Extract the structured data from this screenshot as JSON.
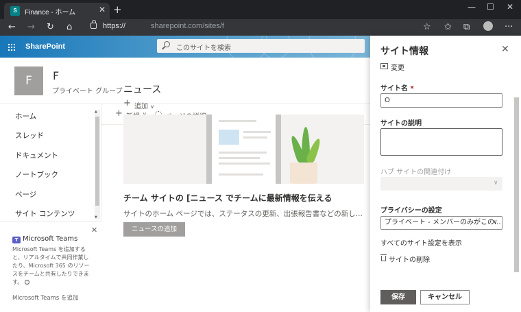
{
  "browser": {
    "tab_title": "Finance - ホーム",
    "tab_favicon": "S",
    "url_prefix": "https://",
    "url_domain": "sharepoint.com/sites/f",
    "icons": [
      "back-icon",
      "forward-icon",
      "refresh-icon",
      "home-icon",
      "lock-icon",
      "star-icon",
      "favorites-icon",
      "collections-icon",
      "profile-icon",
      "more-icon"
    ]
  },
  "suitebar": {
    "brand": "SharePoint",
    "search_placeholder": "このサイトを検索"
  },
  "site": {
    "logo_letter": "F",
    "title": "F",
    "subtitle": "プライベート グループ"
  },
  "nav": {
    "items": [
      "ホーム",
      "スレッド",
      "ドキュメント",
      "ノートブック",
      "ページ",
      "サイト コンテンツ"
    ]
  },
  "teams": {
    "title": "Microsoft Teams",
    "description": "Microsoft Teams を追加すると、リアルタイムで共同作業したり、Microsoft 365 のリソースをチームと共有したりできます。",
    "add_link": "Microsoft Teams を追加"
  },
  "commands": {
    "new": "新規",
    "page_details": "ページの詳細"
  },
  "news": {
    "title": "ニュース",
    "add": "追加",
    "headline": "チーム サイトの [ニュース でチームに最新情報を伝える",
    "body": "サイトのホーム ページでは、ステータスの更新、出張報告書などの新し...",
    "add_button": "ニュースの追加"
  },
  "panel": {
    "title": "サイト情報",
    "change": "変更",
    "site_name_label": "サイト名",
    "required_mark": "*",
    "site_name_value": "O",
    "description_label": "サイトの説明",
    "hub_label": "ハブ サイトの関連付け",
    "privacy_label": "プライバシーの設定",
    "privacy_value": "プライベート - メンバーのみがこの...",
    "view_all_settings": "すべてのサイト設定を表示",
    "delete_site": "サイトの削除",
    "save": "保存",
    "cancel": "キャンセル"
  },
  "colors": {
    "suitebar_accent": "#1877b9",
    "browser_dark": "#202124",
    "primary_button": "#605e5c"
  }
}
